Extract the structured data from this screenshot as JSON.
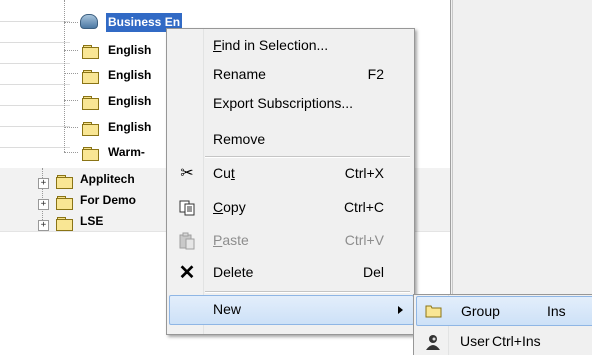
{
  "tree": {
    "nodes": [
      {
        "label": "Business En",
        "selected": true,
        "icon": "globe-folder-icon"
      },
      {
        "label": "English",
        "icon": "folder-icon"
      },
      {
        "label": "English",
        "icon": "folder-icon"
      },
      {
        "label": "English",
        "icon": "folder-icon"
      },
      {
        "label": "English",
        "icon": "folder-icon"
      },
      {
        "label": "Warm-",
        "icon": "folder-icon"
      },
      {
        "label": "Applitech",
        "icon": "folder-icon",
        "expander": "+"
      },
      {
        "label": "For Demo",
        "icon": "folder-icon",
        "expander": "+"
      },
      {
        "label": "LSE",
        "icon": "folder-icon",
        "expander": "+"
      }
    ]
  },
  "context_menu": {
    "items": [
      {
        "label": "Find in Selection...",
        "mnemonic": "F",
        "rest": "ind in Selection...",
        "shortcut": ""
      },
      {
        "label": "Rename",
        "shortcut": "F2"
      },
      {
        "label": "Export Subscriptions...",
        "shortcut": ""
      },
      {
        "label": "Remove",
        "shortcut": ""
      },
      {
        "label": "Cut",
        "pre": "Cu",
        "mnemonic": "t",
        "post": "",
        "shortcut": "Ctrl+X",
        "icon": "scissors-icon"
      },
      {
        "label": "Copy",
        "pre": "",
        "mnemonic": "C",
        "post": "opy",
        "shortcut": "Ctrl+C",
        "icon": "copy-icon"
      },
      {
        "label": "Paste",
        "pre": "",
        "mnemonic": "P",
        "post": "aste",
        "shortcut": "Ctrl+V",
        "icon": "paste-icon",
        "disabled": true
      },
      {
        "label": "Delete",
        "shortcut": "Del",
        "icon": "delete-x-icon"
      },
      {
        "label": "New",
        "shortcut": "",
        "submenu": true,
        "highlight": true
      }
    ]
  },
  "sub_menu": {
    "items": [
      {
        "label": "Group",
        "shortcut": "Ins",
        "icon": "folder-icon",
        "highlight": true
      },
      {
        "label": "User",
        "shortcut": "Ctrl+Ins",
        "icon": "user-icon"
      }
    ]
  }
}
